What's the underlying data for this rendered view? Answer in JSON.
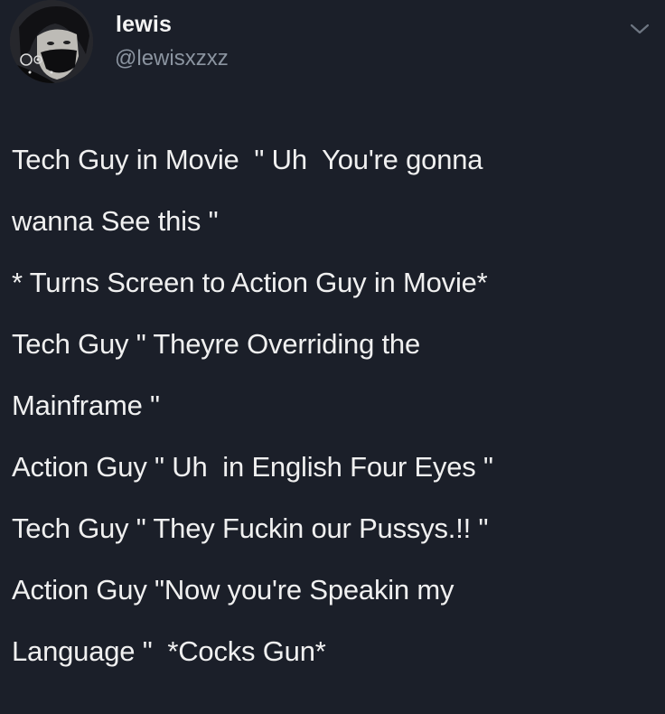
{
  "user": {
    "display_name": "lewis",
    "handle": "@lewisxzxz"
  },
  "icons": {
    "avatar": "profile-avatar",
    "menu": "chevron-down-icon"
  },
  "colors": {
    "background": "#1b1f29",
    "text": "#f0f0f0",
    "handle": "#8b94a0"
  },
  "tweet": {
    "lines": [
      "Tech Guy in Movie  \" Uh  You're gonna",
      "wanna See this \"",
      "* Turns Screen to Action Guy in Movie*",
      "Tech Guy \" Theyre Overriding the",
      "Mainframe \"",
      "Action Guy \" Uh  in English Four Eyes \"",
      "Tech Guy \" They Fuckin our Pussys.!! \"",
      "Action Guy \"Now you're Speakin my",
      "Language \"  *Cocks Gun*"
    ]
  }
}
